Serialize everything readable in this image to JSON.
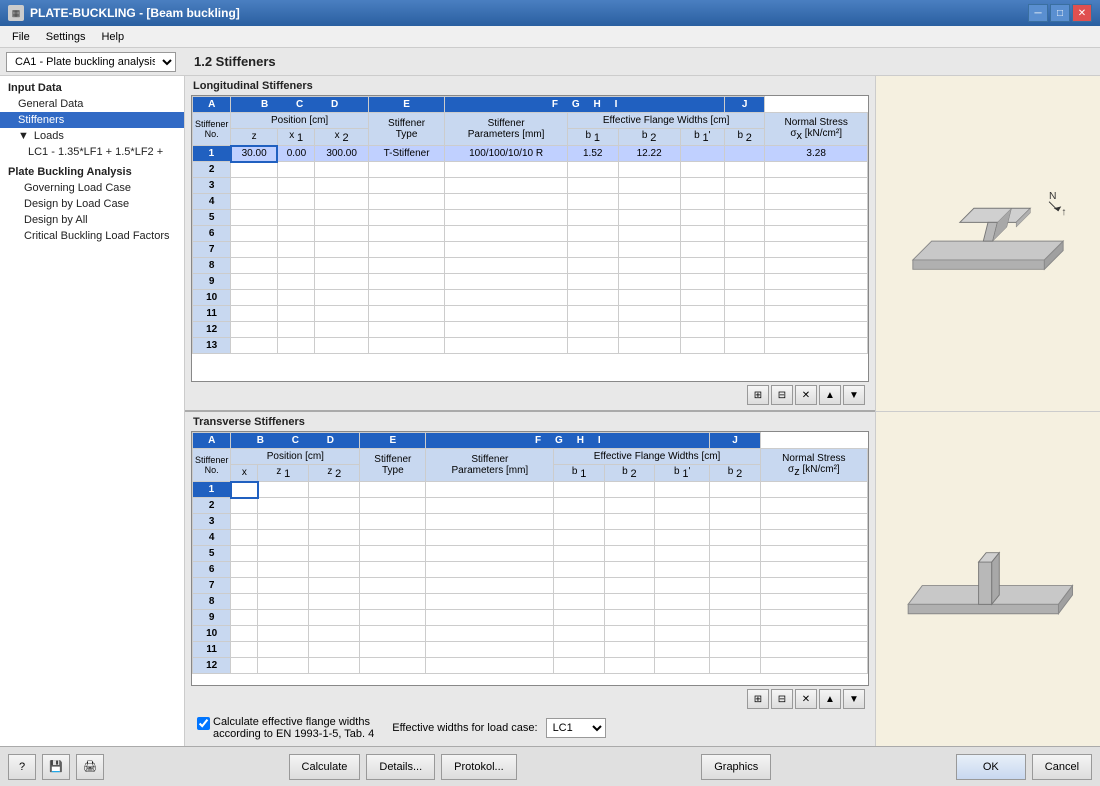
{
  "titleBar": {
    "appName": "PLATE-BUCKLING",
    "subtitle": "Beam buckling",
    "fullTitle": "PLATE-BUCKLING - [Beam buckling]",
    "closeBtn": "✕",
    "minBtn": "─",
    "maxBtn": "□"
  },
  "menuBar": {
    "items": [
      "File",
      "Settings",
      "Help"
    ]
  },
  "dropdownBar": {
    "selectedOption": "CA1 - Plate buckling analysis",
    "options": [
      "CA1 - Plate buckling analysis"
    ],
    "sectionTitle": "1.2 Stiffeners"
  },
  "sidebar": {
    "inputDataLabel": "Input Data",
    "generalDataLabel": "General Data",
    "stiffenersLabel": "Stiffeners",
    "loadsLabel": "Loads",
    "lcItem": "LC1 - 1.35*LF1 + 1.5*LF2 +",
    "plateBucklingLabel": "Plate Buckling Analysis",
    "governingLoadCase": "Governing Load Case",
    "designByLoadCase": "Design by Load Case",
    "designByAll": "Design by All",
    "criticalBuckling": "Critical Buckling Load Factors"
  },
  "longitudinalStiffeners": {
    "title": "Longitudinal Stiffeners",
    "colHeaders": [
      "A",
      "B",
      "C",
      "D",
      "E",
      "F",
      "G",
      "H",
      "I",
      "J"
    ],
    "subHeaders": {
      "stiffenerNo": "Stiffener No.",
      "positionCm": "Position [cm]",
      "z": "z",
      "x1": "x 1",
      "x2": "x 2",
      "stiffenerType": "Stiffener Type",
      "stiffenerParams": "Stiffener Parameters [mm]",
      "effectiveFlange": "Effective Flange Widths [cm]",
      "b1": "b 1",
      "b2p": "b 1'",
      "b2": "b 2",
      "b2b": "b 2",
      "normalStress": "Normal Stress",
      "sigma": "σ x [kN/cm²]"
    },
    "rows": [
      {
        "no": 1,
        "z": "30.00",
        "x1": "0.00",
        "x2": "300.00",
        "type": "T-Stiffener",
        "params": "100/100/10/10 R",
        "b1": "1.52",
        "b2": "12.22",
        "b1p": "",
        "b2b": "",
        "stress": "3.28",
        "selected": true
      },
      {
        "no": 2,
        "z": "",
        "x1": "",
        "x2": "",
        "type": "",
        "params": "",
        "b1": "",
        "b2": "",
        "b1p": "",
        "b2b": "",
        "stress": ""
      },
      {
        "no": 3,
        "z": "",
        "x1": "",
        "x2": "",
        "type": "",
        "params": "",
        "b1": "",
        "b2": "",
        "b1p": "",
        "b2b": "",
        "stress": ""
      },
      {
        "no": 4,
        "z": "",
        "x1": "",
        "x2": "",
        "type": "",
        "params": "",
        "b1": "",
        "b2": "",
        "b1p": "",
        "b2b": "",
        "stress": ""
      },
      {
        "no": 5,
        "z": "",
        "x1": "",
        "x2": "",
        "type": "",
        "params": "",
        "b1": "",
        "b2": "",
        "b1p": "",
        "b2b": "",
        "stress": ""
      },
      {
        "no": 6,
        "z": "",
        "x1": "",
        "x2": "",
        "type": "",
        "params": "",
        "b1": "",
        "b2": "",
        "b1p": "",
        "b2b": "",
        "stress": ""
      },
      {
        "no": 7,
        "z": "",
        "x1": "",
        "x2": "",
        "type": "",
        "params": "",
        "b1": "",
        "b2": "",
        "b1p": "",
        "b2b": "",
        "stress": ""
      },
      {
        "no": 8,
        "z": "",
        "x1": "",
        "x2": "",
        "type": "",
        "params": "",
        "b1": "",
        "b2": "",
        "b1p": "",
        "b2b": "",
        "stress": ""
      },
      {
        "no": 9,
        "z": "",
        "x1": "",
        "x2": "",
        "type": "",
        "params": "",
        "b1": "",
        "b2": "",
        "b1p": "",
        "b2b": "",
        "stress": ""
      },
      {
        "no": 10,
        "z": "",
        "x1": "",
        "x2": "",
        "type": "",
        "params": "",
        "b1": "",
        "b2": "",
        "b1p": "",
        "b2b": "",
        "stress": ""
      },
      {
        "no": 11,
        "z": "",
        "x1": "",
        "x2": "",
        "type": "",
        "params": "",
        "b1": "",
        "b2": "",
        "b1p": "",
        "b2b": "",
        "stress": ""
      },
      {
        "no": 12,
        "z": "",
        "x1": "",
        "x2": "",
        "type": "",
        "params": "",
        "b1": "",
        "b2": "",
        "b1p": "",
        "b2b": "",
        "stress": ""
      },
      {
        "no": 13,
        "z": "",
        "x1": "",
        "x2": "",
        "type": "",
        "params": "",
        "b1": "",
        "b2": "",
        "b1p": "",
        "b2b": "",
        "stress": ""
      }
    ]
  },
  "transverseStiffeners": {
    "title": "Transverse Stiffeners",
    "colHeaders": [
      "A",
      "B",
      "C",
      "D",
      "E",
      "F",
      "G",
      "H",
      "I",
      "J"
    ],
    "subHeaders": {
      "stiffenerNo": "Stiffener No.",
      "positionCm": "Position [cm]",
      "x": "x",
      "z1": "z 1",
      "z2": "z 2",
      "stiffenerType": "Stiffener Type",
      "stiffenerParams": "Stiffener Parameters [mm]",
      "effectiveFlange": "Effective Flange Widths [cm]",
      "b1": "b 1",
      "b2": "b 2",
      "b1p": "b 1'",
      "b2b": "b 2",
      "normalStress": "Normal Stress",
      "sigma": "σ z [kN/cm²]"
    },
    "rows": [
      {
        "no": 1,
        "x": "",
        "z1": "",
        "z2": "",
        "type": "",
        "params": "",
        "b1": "",
        "b2": "",
        "b1p": "",
        "b2b": "",
        "stress": "",
        "selected": true
      },
      {
        "no": 2
      },
      {
        "no": 3
      },
      {
        "no": 4
      },
      {
        "no": 5
      },
      {
        "no": 6
      },
      {
        "no": 7
      },
      {
        "no": 8
      },
      {
        "no": 9
      },
      {
        "no": 10
      },
      {
        "no": 11
      },
      {
        "no": 12
      }
    ]
  },
  "bottomOptions": {
    "checkboxChecked": true,
    "checkboxLabel1": "Calculate effective flange widths",
    "checkboxLabel2": "according to EN 1993-1-5, Tab. 4",
    "effectiveWidthsLabel": "Effective widths for load case:",
    "loadCaseOptions": [
      "LC1"
    ],
    "selectedLC": "LC1"
  },
  "footer": {
    "calculateBtn": "Calculate",
    "detailsBtn": "Details...",
    "protokolBtn": "Protokol...",
    "graphicsBtn": "Graphics",
    "okBtn": "OK",
    "cancelBtn": "Cancel"
  },
  "toolbarIcons": {
    "icon1": "⊞",
    "icon2": "⊟",
    "icon3": "✕",
    "icon4": "⬆",
    "icon5": "⬇"
  }
}
